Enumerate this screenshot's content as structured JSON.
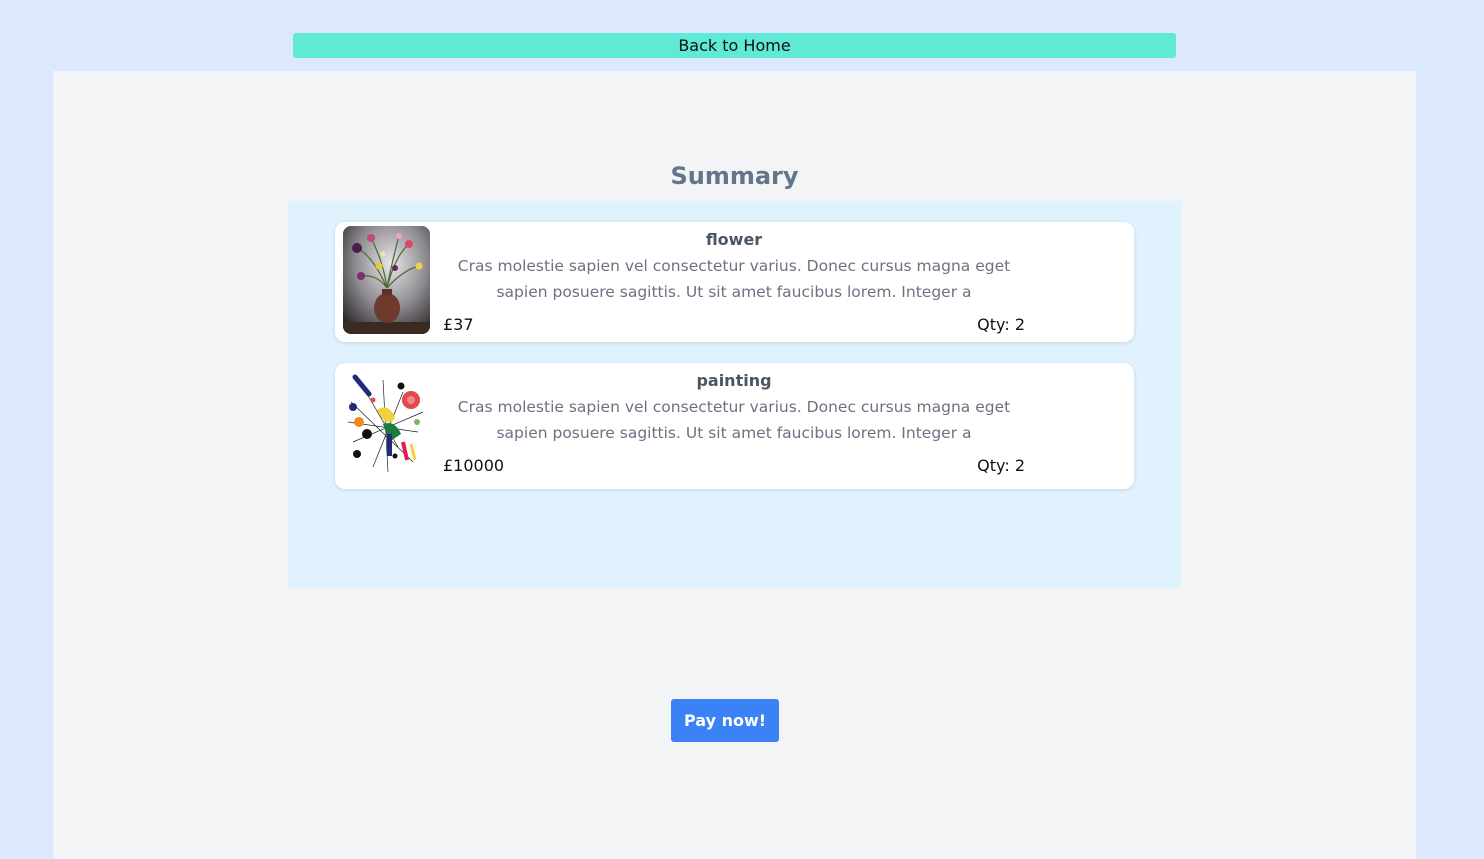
{
  "nav": {
    "back_label": "Back to Home"
  },
  "summary": {
    "title": "Summary",
    "items": [
      {
        "name": "flower",
        "description": "Cras molestie sapien vel consectetur varius. Donec cursus magna eget sapien posuere sagittis. Ut sit amet faucibus lorem. Integer a",
        "price": "£37",
        "qty": "Qty: 2",
        "image": "flower-vase-image"
      },
      {
        "name": "painting",
        "description": "Cras molestie sapien vel consectetur varius. Donec cursus magna eget sapien posuere sagittis. Ut sit amet faucibus lorem. Integer a",
        "price": "£10000",
        "qty": "Qty: 2",
        "image": "abstract-painting-image"
      }
    ]
  },
  "checkout": {
    "pay_label": "Pay now!"
  },
  "colors": {
    "page_bg": "#dbe8fd",
    "back_button": "#5eead4",
    "summary_box": "#e0f2fe",
    "pay_button": "#3b82f6"
  }
}
